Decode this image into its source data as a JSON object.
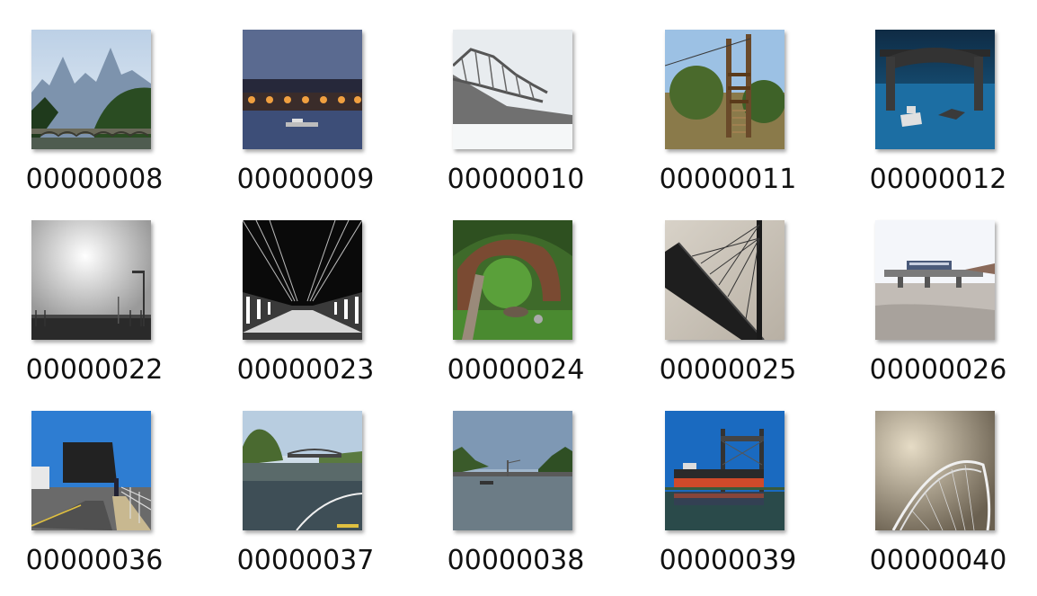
{
  "items": [
    {
      "label": "00000008",
      "thumb": "mountain-river-bridge"
    },
    {
      "label": "00000009",
      "thumb": "night-arch-bridge"
    },
    {
      "label": "00000010",
      "thumb": "foggy-truss-bridge"
    },
    {
      "label": "00000011",
      "thumb": "rope-bridge-forest"
    },
    {
      "label": "00000012",
      "thumb": "arch-bridge-boat"
    },
    {
      "label": "00000022",
      "thumb": "foggy-lamp-bridge"
    },
    {
      "label": "00000023",
      "thumb": "cable-walkway"
    },
    {
      "label": "00000024",
      "thumb": "stone-arch-garden"
    },
    {
      "label": "00000025",
      "thumb": "cable-stayed-underside"
    },
    {
      "label": "00000026",
      "thumb": "train-on-bridge"
    },
    {
      "label": "00000036",
      "thumb": "bascule-bridge-street"
    },
    {
      "label": "00000037",
      "thumb": "river-footbridge"
    },
    {
      "label": "00000038",
      "thumb": "river-boats"
    },
    {
      "label": "00000039",
      "thumb": "ship-lift-bridge"
    },
    {
      "label": "00000040",
      "thumb": "arch-cloudy-sky"
    }
  ]
}
